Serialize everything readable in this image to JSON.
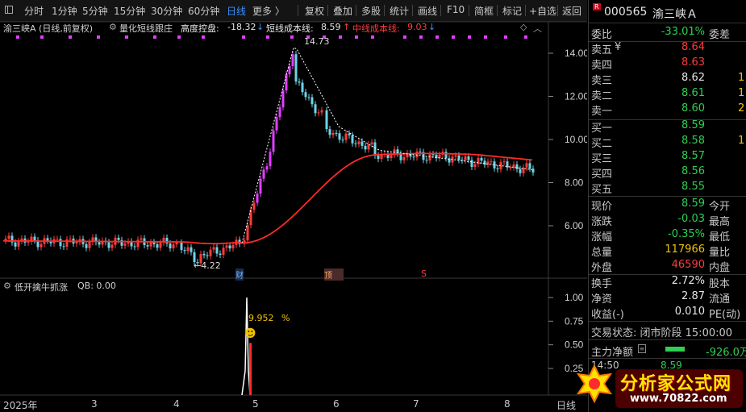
{
  "toolbar": {
    "items": [
      "分时",
      "1分钟",
      "5分钟",
      "15分钟",
      "30分钟",
      "60分钟",
      "日线",
      "更多 〉",
      "复权",
      "叠加",
      "多股",
      "统计",
      "画线",
      "F10",
      "简框",
      "标记",
      "+自选",
      "返回"
    ],
    "active": "日线"
  },
  "infobar": {
    "stock": "渝三峡A (日线,前复权)",
    "indicator": "量化短线跟庄",
    "height_label": "高度控盘:",
    "height_value": "-18.32",
    "short_label": "短线成本线:",
    "short_value": "8.59",
    "mid_label": "中线成本线:",
    "mid_value": "9.03"
  },
  "main_axis": {
    "ticks": [
      "14.00",
      "12.00",
      "10.00",
      "8.00",
      "6.00"
    ]
  },
  "annotations": {
    "high": "14.73",
    "low": "←4.22",
    "tag_cai": "财",
    "tag_ding": "顶",
    "tag_s": "S"
  },
  "sub_panel": {
    "title": "低开擒牛抓涨",
    "qb_label": "QB: 0.00",
    "value_label": "9.952",
    "percent": "%",
    "ticks": [
      "1.00",
      "0.75",
      "0.50",
      "0.25"
    ]
  },
  "x_axis": {
    "labels": [
      "2025年",
      "3",
      "4",
      "5",
      "6",
      "7",
      "8"
    ],
    "period": "日线"
  },
  "colors": {
    "up": "#ff3b3b",
    "down": "#2fcf52",
    "accent": "#3a8fff",
    "magenta": "#e040fb",
    "cyan": "#6fd3e8",
    "yellow": "#f2c200"
  },
  "panel": {
    "code": "000565",
    "name": "渝三峡Ａ",
    "weibi_label": "委比",
    "weibi_value": "-33.01%",
    "weicha_label": "委差",
    "asks": [
      {
        "label": "卖五",
        "value": "8.64",
        "mark": "¥",
        "color": "red"
      },
      {
        "label": "卖四",
        "value": "8.63",
        "color": "red"
      },
      {
        "label": "卖三",
        "value": "8.62",
        "color": "white",
        "tail": "1"
      },
      {
        "label": "卖二",
        "value": "8.61",
        "color": "green",
        "tail": "1"
      },
      {
        "label": "卖一",
        "value": "8.60",
        "color": "green",
        "tail": "2"
      }
    ],
    "bids": [
      {
        "label": "买一",
        "value": "8.59",
        "color": "green"
      },
      {
        "label": "买二",
        "value": "8.58",
        "color": "green",
        "tail": "1"
      },
      {
        "label": "买三",
        "value": "8.57",
        "color": "green"
      },
      {
        "label": "买四",
        "value": "8.56",
        "color": "green"
      },
      {
        "label": "买五",
        "value": "8.55",
        "color": "green"
      }
    ],
    "stats": [
      {
        "label": "现价",
        "value": "8.59",
        "color": "green",
        "extra": "今开"
      },
      {
        "label": "涨跌",
        "value": "-0.03",
        "color": "green",
        "extra": "最高"
      },
      {
        "label": "涨幅",
        "value": "-0.35%",
        "color": "green",
        "extra": "最低"
      },
      {
        "label": "总量",
        "value": "117966",
        "color": "yellow",
        "extra": "量比"
      },
      {
        "label": "外盘",
        "value": "46590",
        "color": "red",
        "extra": "内盘"
      }
    ],
    "fund": [
      {
        "label": "换手",
        "value": "2.72%",
        "extra": "股本"
      },
      {
        "label": "净资",
        "value": "2.87",
        "extra": "流通"
      },
      {
        "label": "收益(-)",
        "value": "0.010",
        "extra": "PE(动)"
      }
    ],
    "trade_state": "交易状态: 闭市阶段 15:00:00",
    "main_flow_label": "主力净额",
    "main_flow_value": "-926.0万",
    "tick_time": "14:50",
    "tick_price": "8.59"
  },
  "watermark": {
    "text": "分析家公式网",
    "url": "www.70822.com"
  }
}
